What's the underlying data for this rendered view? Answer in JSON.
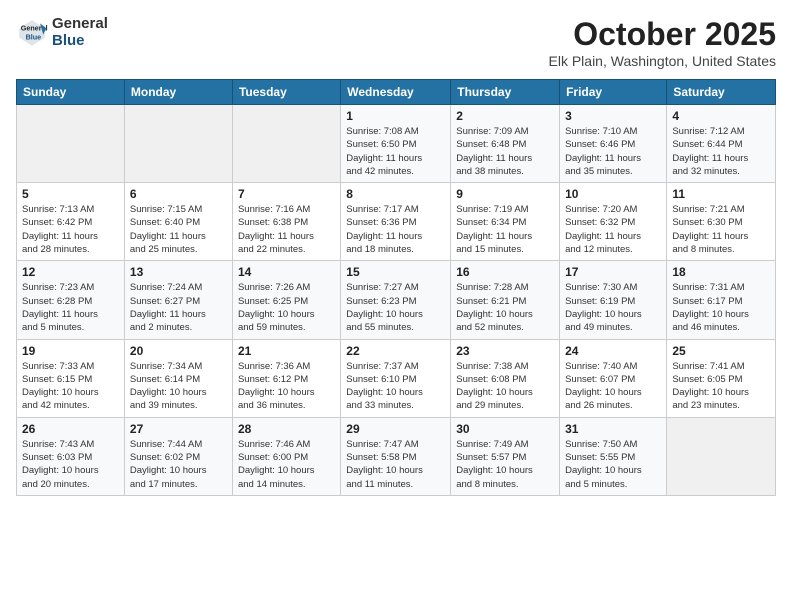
{
  "logo": {
    "general": "General",
    "blue": "Blue"
  },
  "title": "October 2025",
  "location": "Elk Plain, Washington, United States",
  "days_of_week": [
    "Sunday",
    "Monday",
    "Tuesday",
    "Wednesday",
    "Thursday",
    "Friday",
    "Saturday"
  ],
  "weeks": [
    [
      {
        "day": "",
        "info": ""
      },
      {
        "day": "",
        "info": ""
      },
      {
        "day": "",
        "info": ""
      },
      {
        "day": "1",
        "info": "Sunrise: 7:08 AM\nSunset: 6:50 PM\nDaylight: 11 hours\nand 42 minutes."
      },
      {
        "day": "2",
        "info": "Sunrise: 7:09 AM\nSunset: 6:48 PM\nDaylight: 11 hours\nand 38 minutes."
      },
      {
        "day": "3",
        "info": "Sunrise: 7:10 AM\nSunset: 6:46 PM\nDaylight: 11 hours\nand 35 minutes."
      },
      {
        "day": "4",
        "info": "Sunrise: 7:12 AM\nSunset: 6:44 PM\nDaylight: 11 hours\nand 32 minutes."
      }
    ],
    [
      {
        "day": "5",
        "info": "Sunrise: 7:13 AM\nSunset: 6:42 PM\nDaylight: 11 hours\nand 28 minutes."
      },
      {
        "day": "6",
        "info": "Sunrise: 7:15 AM\nSunset: 6:40 PM\nDaylight: 11 hours\nand 25 minutes."
      },
      {
        "day": "7",
        "info": "Sunrise: 7:16 AM\nSunset: 6:38 PM\nDaylight: 11 hours\nand 22 minutes."
      },
      {
        "day": "8",
        "info": "Sunrise: 7:17 AM\nSunset: 6:36 PM\nDaylight: 11 hours\nand 18 minutes."
      },
      {
        "day": "9",
        "info": "Sunrise: 7:19 AM\nSunset: 6:34 PM\nDaylight: 11 hours\nand 15 minutes."
      },
      {
        "day": "10",
        "info": "Sunrise: 7:20 AM\nSunset: 6:32 PM\nDaylight: 11 hours\nand 12 minutes."
      },
      {
        "day": "11",
        "info": "Sunrise: 7:21 AM\nSunset: 6:30 PM\nDaylight: 11 hours\nand 8 minutes."
      }
    ],
    [
      {
        "day": "12",
        "info": "Sunrise: 7:23 AM\nSunset: 6:28 PM\nDaylight: 11 hours\nand 5 minutes."
      },
      {
        "day": "13",
        "info": "Sunrise: 7:24 AM\nSunset: 6:27 PM\nDaylight: 11 hours\nand 2 minutes."
      },
      {
        "day": "14",
        "info": "Sunrise: 7:26 AM\nSunset: 6:25 PM\nDaylight: 10 hours\nand 59 minutes."
      },
      {
        "day": "15",
        "info": "Sunrise: 7:27 AM\nSunset: 6:23 PM\nDaylight: 10 hours\nand 55 minutes."
      },
      {
        "day": "16",
        "info": "Sunrise: 7:28 AM\nSunset: 6:21 PM\nDaylight: 10 hours\nand 52 minutes."
      },
      {
        "day": "17",
        "info": "Sunrise: 7:30 AM\nSunset: 6:19 PM\nDaylight: 10 hours\nand 49 minutes."
      },
      {
        "day": "18",
        "info": "Sunrise: 7:31 AM\nSunset: 6:17 PM\nDaylight: 10 hours\nand 46 minutes."
      }
    ],
    [
      {
        "day": "19",
        "info": "Sunrise: 7:33 AM\nSunset: 6:15 PM\nDaylight: 10 hours\nand 42 minutes."
      },
      {
        "day": "20",
        "info": "Sunrise: 7:34 AM\nSunset: 6:14 PM\nDaylight: 10 hours\nand 39 minutes."
      },
      {
        "day": "21",
        "info": "Sunrise: 7:36 AM\nSunset: 6:12 PM\nDaylight: 10 hours\nand 36 minutes."
      },
      {
        "day": "22",
        "info": "Sunrise: 7:37 AM\nSunset: 6:10 PM\nDaylight: 10 hours\nand 33 minutes."
      },
      {
        "day": "23",
        "info": "Sunrise: 7:38 AM\nSunset: 6:08 PM\nDaylight: 10 hours\nand 29 minutes."
      },
      {
        "day": "24",
        "info": "Sunrise: 7:40 AM\nSunset: 6:07 PM\nDaylight: 10 hours\nand 26 minutes."
      },
      {
        "day": "25",
        "info": "Sunrise: 7:41 AM\nSunset: 6:05 PM\nDaylight: 10 hours\nand 23 minutes."
      }
    ],
    [
      {
        "day": "26",
        "info": "Sunrise: 7:43 AM\nSunset: 6:03 PM\nDaylight: 10 hours\nand 20 minutes."
      },
      {
        "day": "27",
        "info": "Sunrise: 7:44 AM\nSunset: 6:02 PM\nDaylight: 10 hours\nand 17 minutes."
      },
      {
        "day": "28",
        "info": "Sunrise: 7:46 AM\nSunset: 6:00 PM\nDaylight: 10 hours\nand 14 minutes."
      },
      {
        "day": "29",
        "info": "Sunrise: 7:47 AM\nSunset: 5:58 PM\nDaylight: 10 hours\nand 11 minutes."
      },
      {
        "day": "30",
        "info": "Sunrise: 7:49 AM\nSunset: 5:57 PM\nDaylight: 10 hours\nand 8 minutes."
      },
      {
        "day": "31",
        "info": "Sunrise: 7:50 AM\nSunset: 5:55 PM\nDaylight: 10 hours\nand 5 minutes."
      },
      {
        "day": "",
        "info": ""
      }
    ]
  ]
}
